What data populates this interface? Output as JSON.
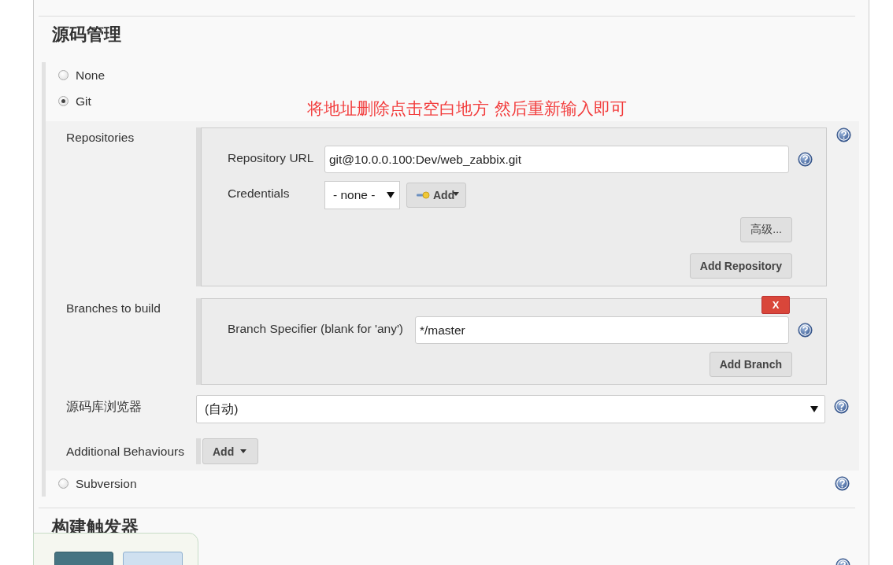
{
  "section_title": "源码管理",
  "scm_options": [
    {
      "label": "None",
      "selected": false
    },
    {
      "label": "Git",
      "selected": true
    },
    {
      "label": "Subversion",
      "selected": false
    }
  ],
  "annotation": "将地址删除点击空白地方 然后重新输入即可",
  "git": {
    "repositories": {
      "label": "Repositories",
      "url_label": "Repository URL",
      "url": "git@10.0.0.100:Dev/web_zabbix.git",
      "credentials_label": "Credentials",
      "credentials": "- none -",
      "add_button": "Add",
      "advanced_button": "高级...",
      "add_repository_button": "Add Repository"
    },
    "branches": {
      "label": "Branches to build",
      "delete_button": "X",
      "specifier_label": "Branch Specifier (blank for 'any')",
      "specifier": "*/master",
      "add_branch_button": "Add Branch"
    },
    "browser": {
      "label": "源码库浏览器",
      "value": "(自动)"
    },
    "behaviours": {
      "label": "Additional Behaviours",
      "add_button": "Add"
    }
  },
  "next_section_title": "构建触发器"
}
